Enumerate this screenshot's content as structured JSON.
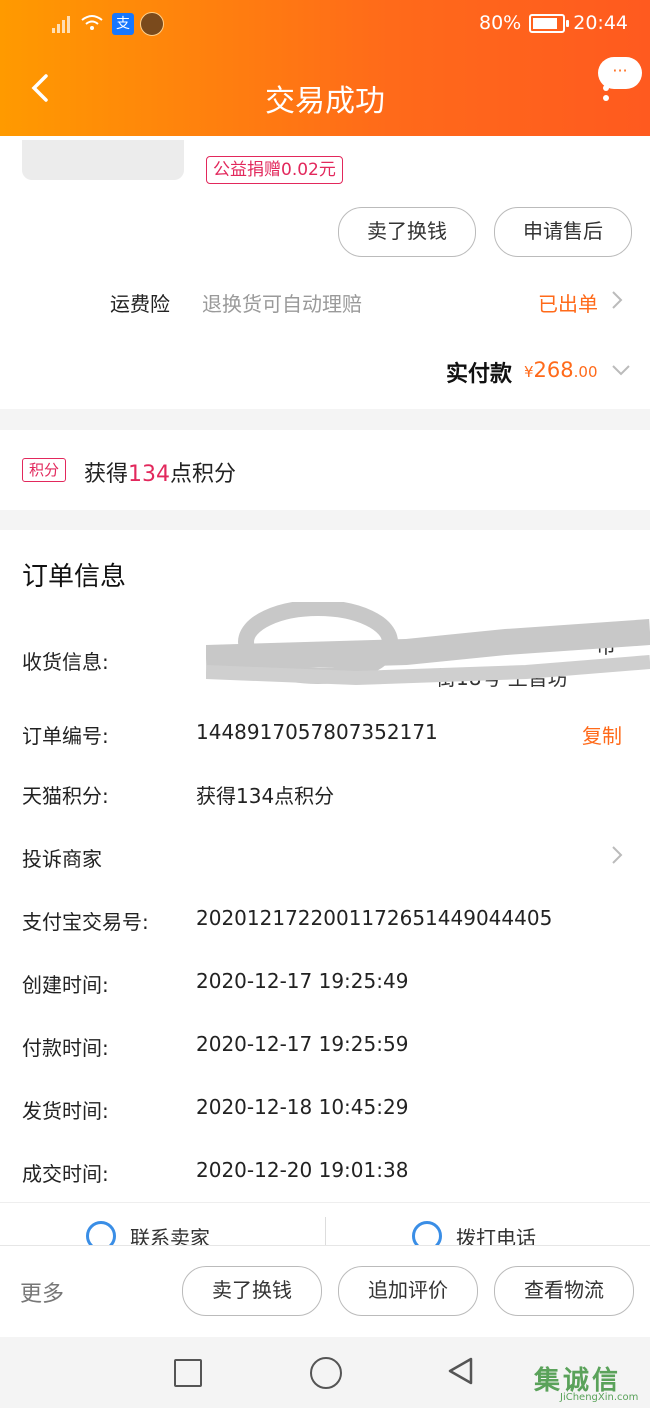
{
  "status_bar": {
    "alipay_glyph": "支",
    "battery": "80%",
    "time": "20:44"
  },
  "header": {
    "back_icon": "chevron-left-icon",
    "title": "交易成功",
    "more_bubble": "···",
    "more_dots": "⋮"
  },
  "item": {
    "charity_badge": "公益捐赠0.02元",
    "actions": [
      "卖了换钱",
      "申请售后"
    ]
  },
  "freight": {
    "label": "运费险",
    "desc": "退换货可自动理赔",
    "status": "已出单"
  },
  "payment": {
    "label": "实付款",
    "currency": "¥",
    "amount_int": "268",
    "amount_dec": ".00"
  },
  "points": {
    "badge": "积分",
    "prefix": "获得",
    "count": "134",
    "suffix": "点积分"
  },
  "order_info": {
    "title": "订单信息",
    "rows": [
      {
        "label": "收货信息:"
      },
      {
        "label": "订单编号:",
        "value": "1448917057807352171",
        "action": "复制"
      },
      {
        "label": "天猫积分:",
        "value": "获得134点积分"
      },
      {
        "label": "投诉商家"
      },
      {
        "label": "支付宝交易号:",
        "value": "2020121722001172651449044405"
      },
      {
        "label": "创建时间:",
        "value": "2020-12-17 19:25:49"
      },
      {
        "label": "付款时间:",
        "value": "2020-12-17 19:25:59"
      },
      {
        "label": "发货时间:",
        "value": "2020-12-18 10:45:29"
      },
      {
        "label": "成交时间:",
        "value": "2020-12-20 19:01:38"
      }
    ],
    "address_partial_1": "市",
    "address_partial_2": "街18号 王皆坊"
  },
  "contact": {
    "seller": "联系卖家",
    "phone": "拨打电话"
  },
  "bottom_bar": {
    "more": "更多",
    "buttons": [
      "卖了换钱",
      "追加评价",
      "查看物流"
    ]
  },
  "watermark": {
    "text": "集诚信",
    "sub": "JiChengXin.com"
  },
  "colors": {
    "accent": "#ff6a1a",
    "pink": "#e2285c"
  }
}
